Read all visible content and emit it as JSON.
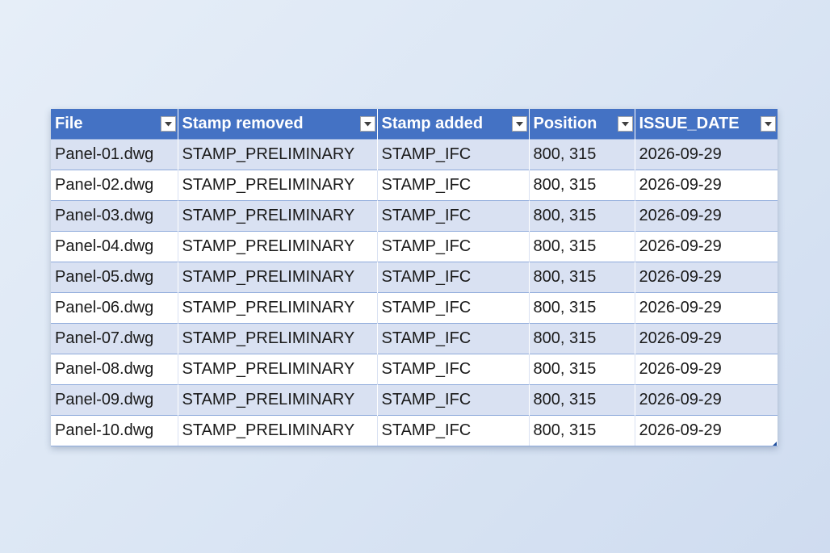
{
  "table": {
    "headers": [
      "File",
      "Stamp removed",
      "Stamp added",
      "Position",
      "ISSUE_DATE"
    ],
    "rows": [
      [
        "Panel-01.dwg",
        "STAMP_PRELIMINARY",
        "STAMP_IFC",
        "800, 315",
        "2026-09-29"
      ],
      [
        "Panel-02.dwg",
        "STAMP_PRELIMINARY",
        "STAMP_IFC",
        "800, 315",
        "2026-09-29"
      ],
      [
        "Panel-03.dwg",
        "STAMP_PRELIMINARY",
        "STAMP_IFC",
        "800, 315",
        "2026-09-29"
      ],
      [
        "Panel-04.dwg",
        "STAMP_PRELIMINARY",
        "STAMP_IFC",
        "800, 315",
        "2026-09-29"
      ],
      [
        "Panel-05.dwg",
        "STAMP_PRELIMINARY",
        "STAMP_IFC",
        "800, 315",
        "2026-09-29"
      ],
      [
        "Panel-06.dwg",
        "STAMP_PRELIMINARY",
        "STAMP_IFC",
        "800, 315",
        "2026-09-29"
      ],
      [
        "Panel-07.dwg",
        "STAMP_PRELIMINARY",
        "STAMP_IFC",
        "800, 315",
        "2026-09-29"
      ],
      [
        "Panel-08.dwg",
        "STAMP_PRELIMINARY",
        "STAMP_IFC",
        "800, 315",
        "2026-09-29"
      ],
      [
        "Panel-09.dwg",
        "STAMP_PRELIMINARY",
        "STAMP_IFC",
        "800, 315",
        "2026-09-29"
      ],
      [
        "Panel-10.dwg",
        "STAMP_PRELIMINARY",
        "STAMP_IFC",
        "800, 315",
        "2026-09-29"
      ]
    ],
    "filter_icon": "filter-dropdown-icon",
    "colors": {
      "header_bg": "#4472c4",
      "band_bg": "#d9e1f2",
      "row_border": "#8eaadb"
    }
  }
}
